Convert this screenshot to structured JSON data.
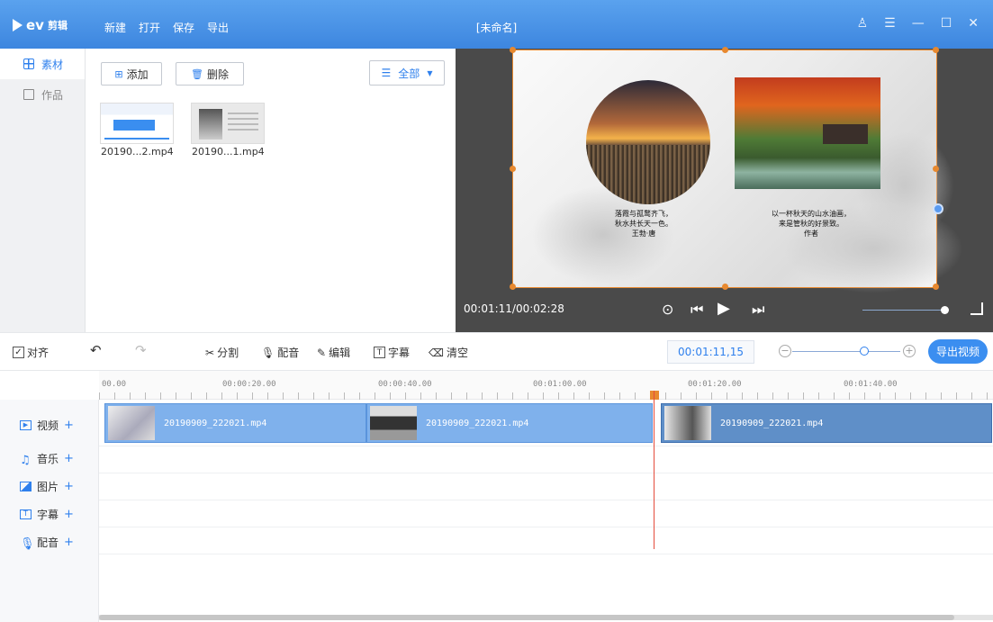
{
  "app": {
    "logo_text": "ev",
    "logo_sub": "剪辑",
    "title": "[未命名]"
  },
  "menu": {
    "new": "新建",
    "open": "打开",
    "save": "保存",
    "export": "导出"
  },
  "sidebar": {
    "items": [
      {
        "label": "素材"
      },
      {
        "label": "作品"
      }
    ]
  },
  "media": {
    "add_label": "添加",
    "delete_label": "删除",
    "filter_label": "全部",
    "files": [
      {
        "name": "20190...2.mp4"
      },
      {
        "name": "20190...1.mp4"
      }
    ]
  },
  "preview": {
    "poem_left": [
      "落霞与孤鹜齐飞，",
      "秋水共长天一色。",
      "王勃·唐"
    ],
    "poem_right": [
      "以一杯秋天的山水油画，",
      "来是管秋的好景致。",
      "作者"
    ],
    "timecode": "00:01:11/00:02:28"
  },
  "toolbar": {
    "align_label": "对齐",
    "split_label": "分割",
    "dub_label": "配音",
    "edit_label": "编辑",
    "subtitle_label": "字幕",
    "clear_label": "清空",
    "time": "00:01:11,15",
    "export_video_label": "导出视频"
  },
  "timeline": {
    "ruler": [
      "00.00",
      "00:00:20.00",
      "00:00:40.00",
      "00:01:00.00",
      "00:01:20.00",
      "00:01:40.00"
    ],
    "tracks": [
      {
        "label": "视频"
      },
      {
        "label": "音乐"
      },
      {
        "label": "图片"
      },
      {
        "label": "字幕"
      },
      {
        "label": "配音"
      }
    ],
    "clips": [
      {
        "name": "20190909_222021.mp4"
      },
      {
        "name": "20190909_222021.mp4"
      },
      {
        "name": "20190909_222021.mp4"
      }
    ]
  },
  "colors": {
    "accent": "#2f80ed",
    "titlebar": "#3d86df",
    "handle": "#e8892f",
    "playhead": "#e44b3c"
  }
}
